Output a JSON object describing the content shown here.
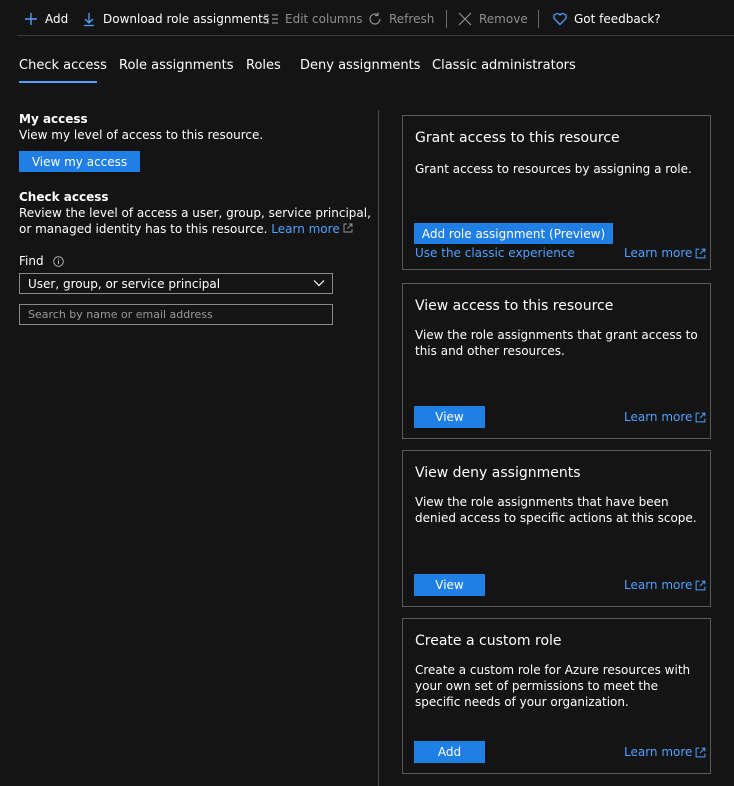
{
  "toolbar": {
    "add_label": "Add",
    "download_label": "Download role assignments",
    "edit_columns_label": "Edit columns",
    "refresh_label": "Refresh",
    "remove_label": "Remove",
    "feedback_label": "Got feedback?"
  },
  "tabs": [
    {
      "label": "Check access",
      "selected": true
    },
    {
      "label": "Role assignments"
    },
    {
      "label": "Roles"
    },
    {
      "label": "Deny assignments"
    },
    {
      "label": "Classic administrators"
    }
  ],
  "left": {
    "my_access_title": "My access",
    "my_access_desc": "View my level of access to this resource.",
    "view_my_access_button": "View my access",
    "check_access_title": "Check access",
    "check_access_desc_1": "Review the level of access a user, group, service principal,",
    "check_access_desc_2": "or managed identity has to this resource.",
    "learn_more": "Learn more",
    "find_label": "Find",
    "find_select_value": "User, group, or service principal",
    "search_placeholder": "Search by name or email address"
  },
  "cards": {
    "grant": {
      "title": "Grant access to this resource",
      "desc": "Grant access to resources by assigning a role.",
      "button": "Add role assignment (Preview)",
      "classic_link": "Use the classic experience",
      "learn_more": "Learn more"
    },
    "view_access": {
      "title": "View access to this resource",
      "desc": "View the role assignments that grant access to this and other resources.",
      "button": "View",
      "learn_more": "Learn more"
    },
    "deny": {
      "title": "View deny assignments",
      "desc": "View the role assignments that have been denied access to specific actions at this scope.",
      "button": "View",
      "learn_more": "Learn more"
    },
    "custom_role": {
      "title": "Create a custom role",
      "desc": "Create a custom role for Azure resources with your own set of permissions to meet the specific needs of your organization.",
      "button": "Add",
      "learn_more": "Learn more"
    }
  },
  "colors": {
    "background": "#141414",
    "accent": "#1f7fe5",
    "link": "#4ea1ff"
  }
}
